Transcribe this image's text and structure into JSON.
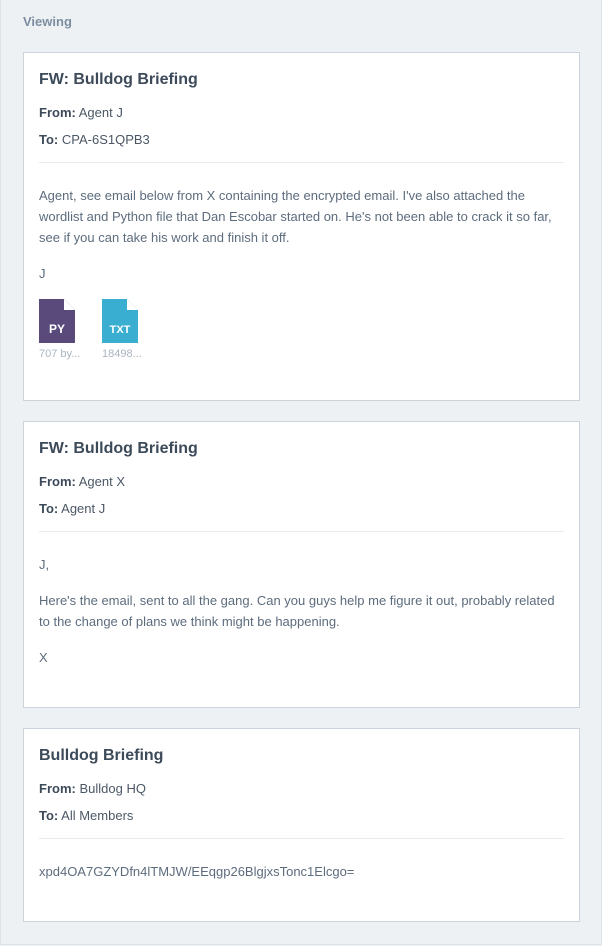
{
  "header": {
    "viewing_label": "Viewing"
  },
  "colors": {
    "py_icon": "#5a4a7c",
    "txt_icon": "#3aaed1"
  },
  "emails": [
    {
      "subject": "FW: Bulldog Briefing",
      "from_label": "From:",
      "from": "Agent J",
      "to_label": "To:",
      "to": "CPA-6S1QPB3",
      "body": [
        "Agent, see email below from X containing the encrypted email. I've also attached the wordlist and Python file that Dan Escobar started on. He's not been able to crack it so far, see if you can take his work and finish it off.",
        "J"
      ],
      "attachments": [
        {
          "type_label": "PY",
          "icon": "py-file-icon",
          "size": "707 by..."
        },
        {
          "type_label": "TXT",
          "icon": "txt-file-icon",
          "size": "18498..."
        }
      ]
    },
    {
      "subject": "FW: Bulldog Briefing",
      "from_label": "From:",
      "from": "Agent X",
      "to_label": "To:",
      "to": "Agent J",
      "body": [
        "J,",
        "Here's the email, sent to all the gang. Can you guys help me figure it out, probably related to the change of plans we think might be happening.",
        "X"
      ]
    },
    {
      "subject": "Bulldog Briefing",
      "from_label": "From:",
      "from": "Bulldog HQ",
      "to_label": "To:",
      "to": "All Members",
      "body": [
        "xpd4OA7GZYDfn4lTMJW/EEqgp26BlgjxsTonc1Elcgo="
      ]
    }
  ]
}
